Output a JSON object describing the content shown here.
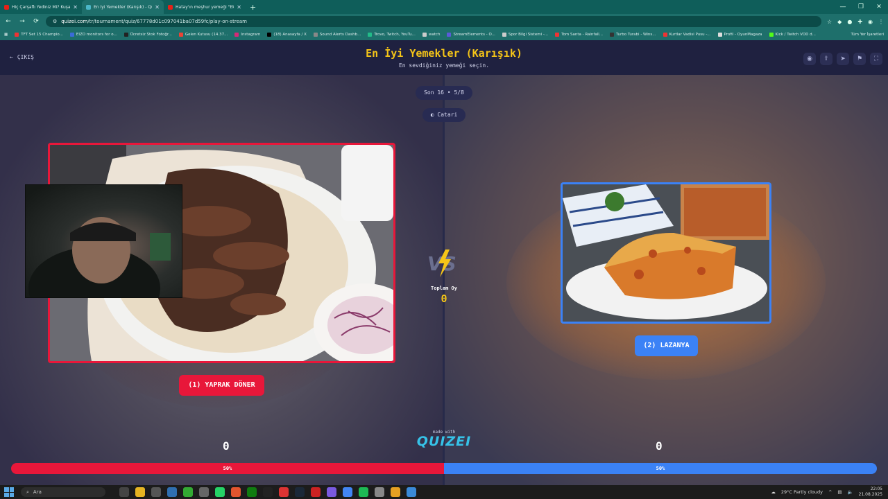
{
  "browser": {
    "tabs": [
      {
        "label": "Hiç Çarşaflı Yediniz Mi? Kuşada...",
        "active": false
      },
      {
        "label": "En İyi Yemekler (Karışık) - Quizei",
        "active": true
      },
      {
        "label": "Hatay'ın meşhur yemeği \"Ekşi...",
        "active": false
      }
    ],
    "url_domain": "quizei.com",
    "url_path": "/tr/tournament/quiz/67778d01c097041ba07d59fc/play-on-stream",
    "bookmarks": [
      "TFT Set 15 Champio...",
      "EIZO monitors for o...",
      "Ücretsiz Stok Fotoğr...",
      "Gelen Kutusu (14.37...",
      "Instagram",
      "(18) Anasayfa / X",
      "Sound Alerts Dashb...",
      "Trovo, Twitch, YouTu...",
      "watch",
      "StreamElements - O...",
      "Spor Bilgi Sistemi -...",
      "Tom Santa - Rainfall...",
      "Turbo Turabi - Wins...",
      "Kurtlar Vadisi Pusu -...",
      "Profil - OyunMagaza",
      "Kick / Twitch VOD d..."
    ],
    "bookmarks_all": "Tüm Yer İşaretleri"
  },
  "header": {
    "exit_label": "ÇIKIŞ",
    "title": "En İyi Yemekler (Karışık)",
    "subtitle": "En sevdiğiniz yemeği seçin."
  },
  "round_label": "Son 16 • 5/8",
  "user_label": "Catari",
  "left": {
    "button_label": "(1) YAPRAK DÖNER",
    "votes": "0",
    "percent": "50%"
  },
  "right": {
    "button_label": "(2) LAZANYA",
    "votes": "0",
    "percent": "50%"
  },
  "total": {
    "label": "Toplam Oy",
    "value": "0"
  },
  "made_with": "made with",
  "logo_text": "QUIZEI",
  "taskbar": {
    "search_placeholder": "Ara",
    "weather": "29°C  Partly cloudy",
    "time": "22:05",
    "date": "21.08.2025"
  },
  "colors": {
    "accent_left": "#e8173a",
    "accent_right": "#3b82f6",
    "title": "#f5c518"
  }
}
